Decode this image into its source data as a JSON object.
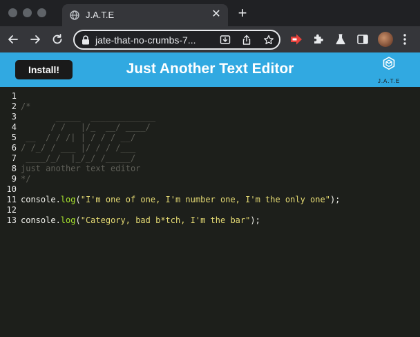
{
  "browser": {
    "tab": {
      "title": "J.A.T.E",
      "close_glyph": "✕",
      "icon": "globe-icon"
    },
    "new_tab_glyph": "+",
    "address": {
      "url": "jate-that-no-crumbs-7..."
    },
    "colors": {
      "tabstrip": "#202124",
      "toolbar": "#35363a"
    }
  },
  "app": {
    "install_label": "Install!",
    "title": "Just Another Text Editor",
    "logo_text": "J.A.T.E",
    "header_color": "#31a9e1"
  },
  "editor": {
    "lines": [
      {
        "n": "1",
        "tokens": []
      },
      {
        "n": "2",
        "tokens": [
          {
            "t": "comment",
            "v": "/*"
          }
        ]
      },
      {
        "n": "3",
        "tokens": [
          {
            "t": "comment",
            "v": "       _____  _____________"
          }
        ]
      },
      {
        "n": "4",
        "tokens": [
          {
            "t": "comment",
            "v": "      / /   |/_  __/ ____/"
          }
        ]
      },
      {
        "n": "5",
        "tokens": [
          {
            "t": "comment",
            "v": " __  / / /| | / / / __/"
          }
        ]
      },
      {
        "n": "6",
        "tokens": [
          {
            "t": "comment",
            "v": "/ /_/ / ___ |/ / / /___"
          }
        ]
      },
      {
        "n": "7",
        "tokens": [
          {
            "t": "comment",
            "v": " ____/_/  |_/_/ /_____/"
          }
        ]
      },
      {
        "n": "8",
        "tokens": [
          {
            "t": "comment",
            "v": "just another text editor"
          }
        ]
      },
      {
        "n": "9",
        "tokens": [
          {
            "t": "comment",
            "v": "*/"
          }
        ]
      },
      {
        "n": "10",
        "tokens": []
      },
      {
        "n": "11",
        "tokens": [
          {
            "t": "plain",
            "v": "console."
          },
          {
            "t": "method",
            "v": "log"
          },
          {
            "t": "plain",
            "v": "("
          },
          {
            "t": "string",
            "v": "\"I'm one of one, I'm number one, I'm the only one\""
          },
          {
            "t": "plain",
            "v": ");"
          }
        ]
      },
      {
        "n": "12",
        "tokens": []
      },
      {
        "n": "13",
        "tokens": [
          {
            "t": "plain",
            "v": "console."
          },
          {
            "t": "method",
            "v": "log"
          },
          {
            "t": "plain",
            "v": "("
          },
          {
            "t": "string",
            "v": "\"Category, bad b*tch, I'm the bar\""
          },
          {
            "t": "plain",
            "v": ");"
          }
        ]
      }
    ]
  }
}
